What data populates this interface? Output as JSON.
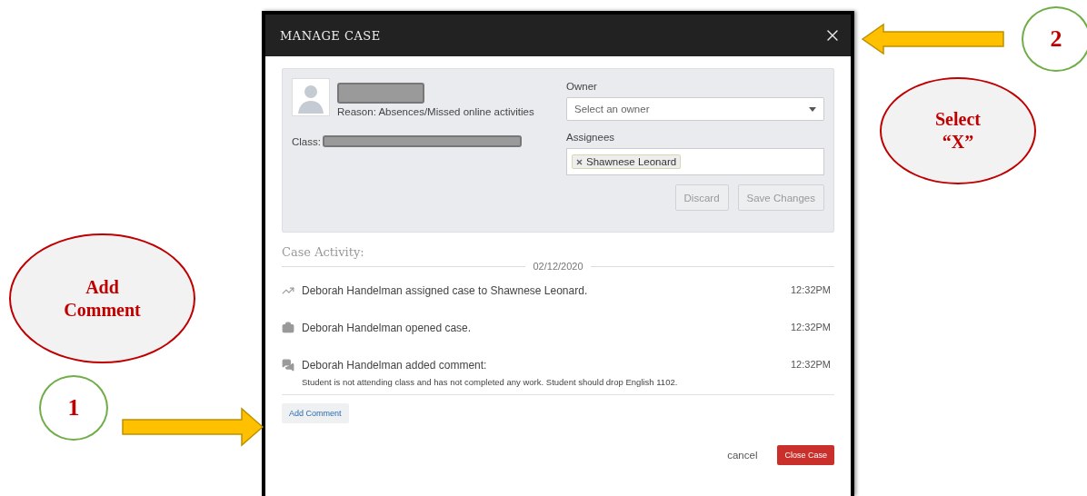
{
  "dialog": {
    "title": "MANAGE CASE",
    "student": {
      "reason": "Reason: Absences/Missed online activities",
      "class_label": "Class:"
    },
    "owner": {
      "label": "Owner",
      "placeholder": "Select an owner"
    },
    "assignees": {
      "label": "Assignees",
      "tags": [
        "Shawnese Leonard"
      ]
    },
    "panel_buttons": [
      {
        "label": "Discard",
        "disabled": true
      },
      {
        "label": "Save Changes",
        "disabled": true
      }
    ],
    "activity": {
      "title": "Case Activity:",
      "date": "02/12/2020",
      "entries": [
        {
          "kind": "assigned",
          "text": "Deborah Handelman assigned case to Shawnese Leonard.",
          "time": "12:32PM"
        },
        {
          "kind": "opened",
          "text": "Deborah Handelman opened case.",
          "time": "12:32PM"
        },
        {
          "kind": "comment",
          "text": "Deborah Handelman added comment:",
          "time": "12:32PM",
          "comment": "Student is not attending class and has not completed any work. Student should drop English 1102."
        }
      ]
    },
    "add_comment": "Add Comment",
    "cancel": "cancel",
    "close_case": "Close Case"
  },
  "annotations": {
    "left": [
      {
        "kind": "ellipse",
        "text": "Add Comment"
      },
      {
        "kind": "circle",
        "text": "1"
      },
      {
        "kind": "arrow-right"
      }
    ],
    "right": [
      {
        "kind": "arrow-left"
      },
      {
        "kind": "circle",
        "text": "2"
      },
      {
        "kind": "ellipse",
        "text": "Select “X”"
      }
    ]
  }
}
